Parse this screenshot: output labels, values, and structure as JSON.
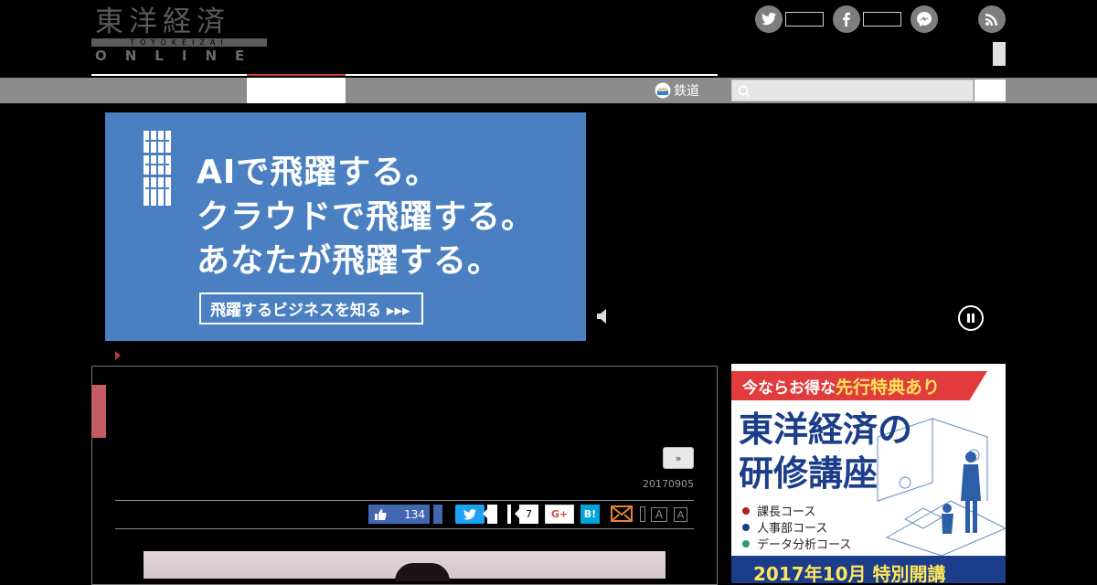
{
  "header": {
    "logo_kanji": "東洋経済",
    "logo_sub": "TOYOKEIZAI",
    "logo_online": "ONLINE",
    "social": [
      "twitter-icon",
      "facebook-icon",
      "messenger-icon",
      "rss-icon"
    ]
  },
  "nav": {
    "railway_label": "鉄道",
    "search_placeholder": ""
  },
  "ad": {
    "brand": "IBM",
    "lines": [
      "AIで飛躍する。",
      "クラウドで飛躍する。",
      "あなたが飛躍する。"
    ],
    "cta": "飛躍するビジネスを知る ▸▸▸"
  },
  "article": {
    "next_label": "»",
    "date": "20170905",
    "share": {
      "fb_count": "134",
      "gplus_count": "7",
      "gplus_label": "G+",
      "hatena_label": "B!",
      "font_small": "A",
      "font_large": "A"
    }
  },
  "side_ad": {
    "badge_pre": "今ならお得な",
    "badge_highlight": "先行特典あり",
    "title_line1": "東洋経済の",
    "title_line2": "研修講座",
    "courses": [
      "課長コース",
      "人事部コース",
      "データ分析コース"
    ],
    "course_colors": [
      "#b01e23",
      "#1b3d8a",
      "#2a9d6e"
    ],
    "footer": "2017年10月 特別開講"
  },
  "colors": {
    "accent_red": "#c2383d",
    "nav_gray": "#8c8c8c",
    "ad_blue": "#4a7fc1"
  }
}
